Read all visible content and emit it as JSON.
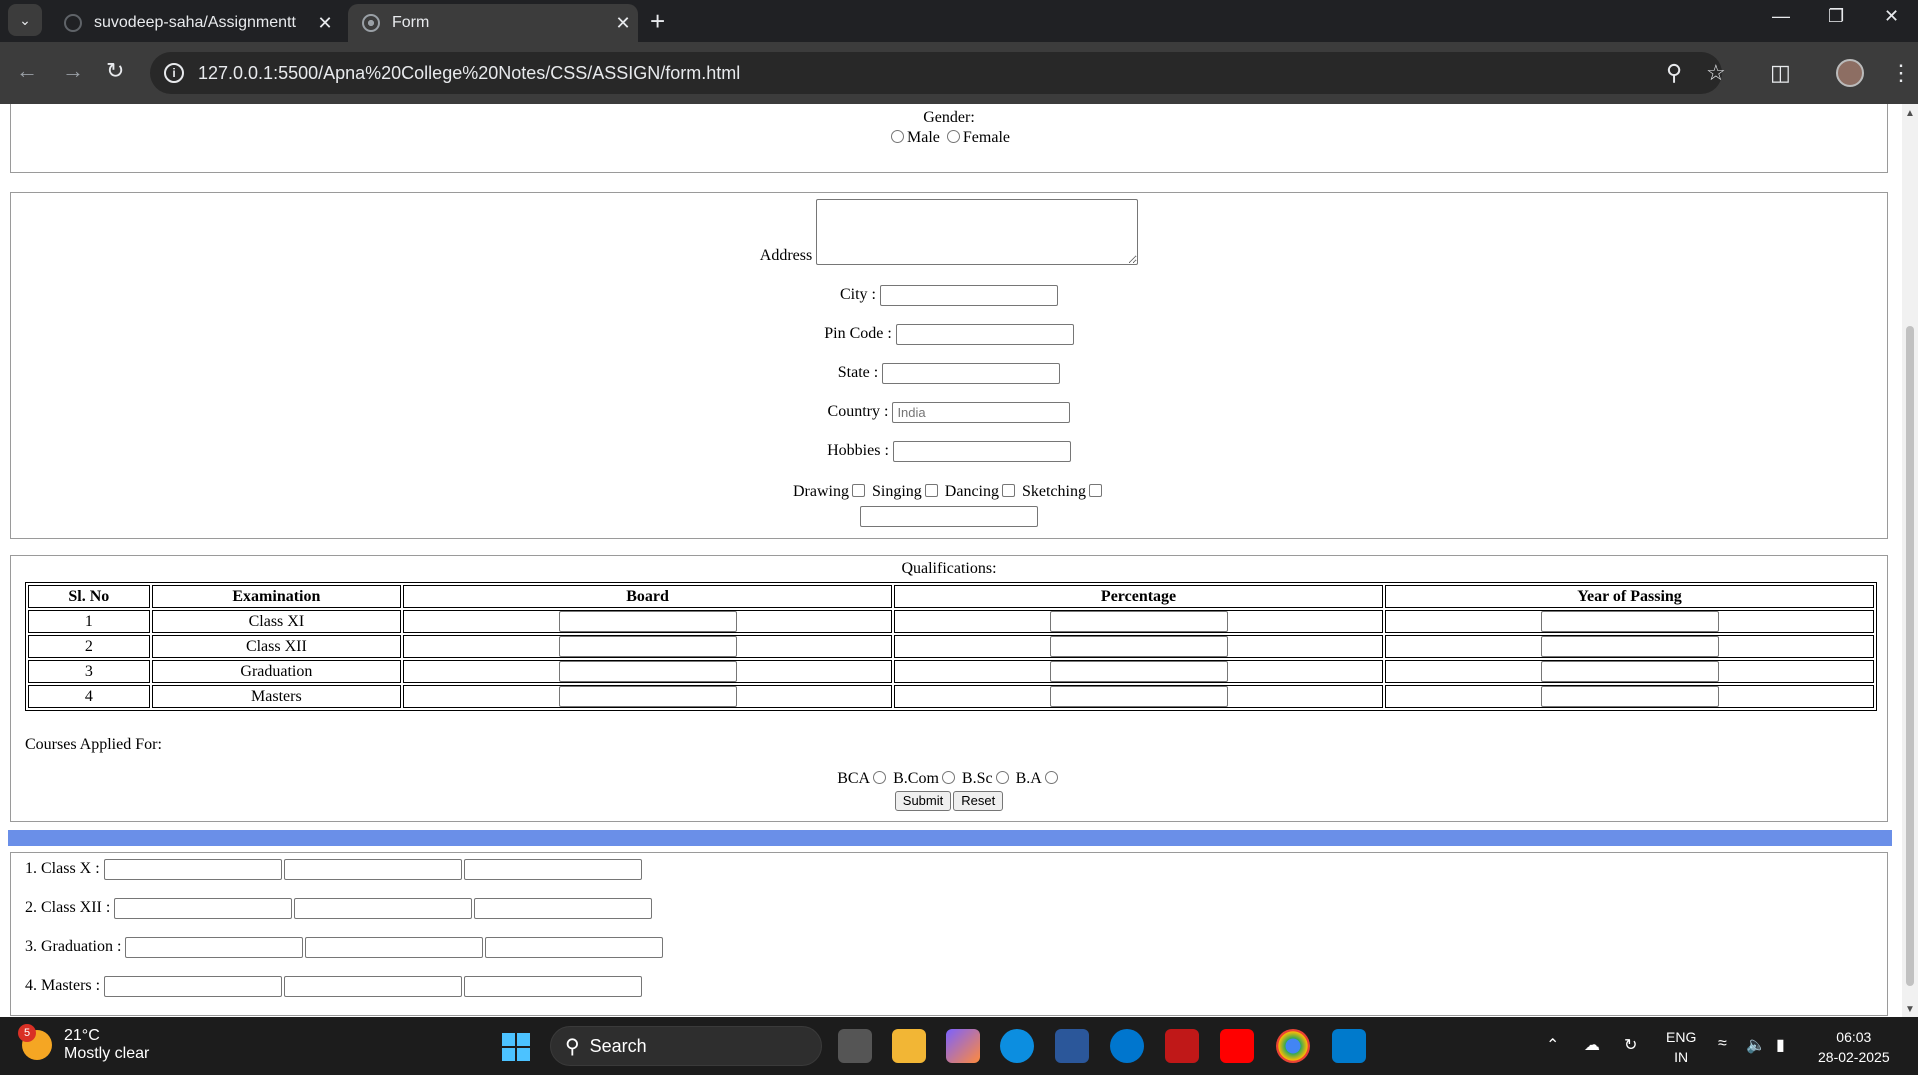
{
  "browser": {
    "tabs": [
      {
        "title": "suvodeep-saha/Assignmentt",
        "active": false
      },
      {
        "title": "Form",
        "active": true
      }
    ],
    "url": "127.0.0.1:5500/Apna%20College%20Notes/CSS/ASSIGN/form.html"
  },
  "gender": {
    "label": "Gender:",
    "options": [
      "Male",
      "Female"
    ]
  },
  "address": {
    "address_label": "Address",
    "city_label": "City :",
    "pincode_label": "Pin Code :",
    "state_label": "State :",
    "country_label": "Country :",
    "country_placeholder": "India",
    "hobbies_label": "Hobbies :",
    "hobby_options": [
      "Drawing",
      "Singing",
      "Dancing",
      "Sketching"
    ]
  },
  "qualifications": {
    "caption": "Qualifications:",
    "headers": [
      "Sl. No",
      "Examination",
      "Board",
      "Percentage",
      "Year of Passing"
    ],
    "rows": [
      {
        "sl": "1",
        "exam": "Class XI"
      },
      {
        "sl": "2",
        "exam": "Class XII"
      },
      {
        "sl": "3",
        "exam": "Graduation"
      },
      {
        "sl": "4",
        "exam": "Masters"
      }
    ],
    "courses_label": "Courses Applied For:",
    "courses": [
      "BCA",
      "B.Com",
      "B.Sc",
      "B.A"
    ],
    "submit_label": "Submit",
    "reset_label": "Reset"
  },
  "colors": {
    "blue_bar": "#6a8fe8"
  },
  "classes": [
    {
      "label": "1. Class X :"
    },
    {
      "label": "2. Class XII :"
    },
    {
      "label": "3. Graduation :"
    },
    {
      "label": "4. Masters :"
    }
  ],
  "taskbar": {
    "weather_badge": "5",
    "temperature": "21°C",
    "condition": "Mostly clear",
    "search_label": "Search",
    "lang_top": "ENG",
    "lang_bottom": "IN",
    "time": "06:03",
    "date": "28-02-2025"
  }
}
